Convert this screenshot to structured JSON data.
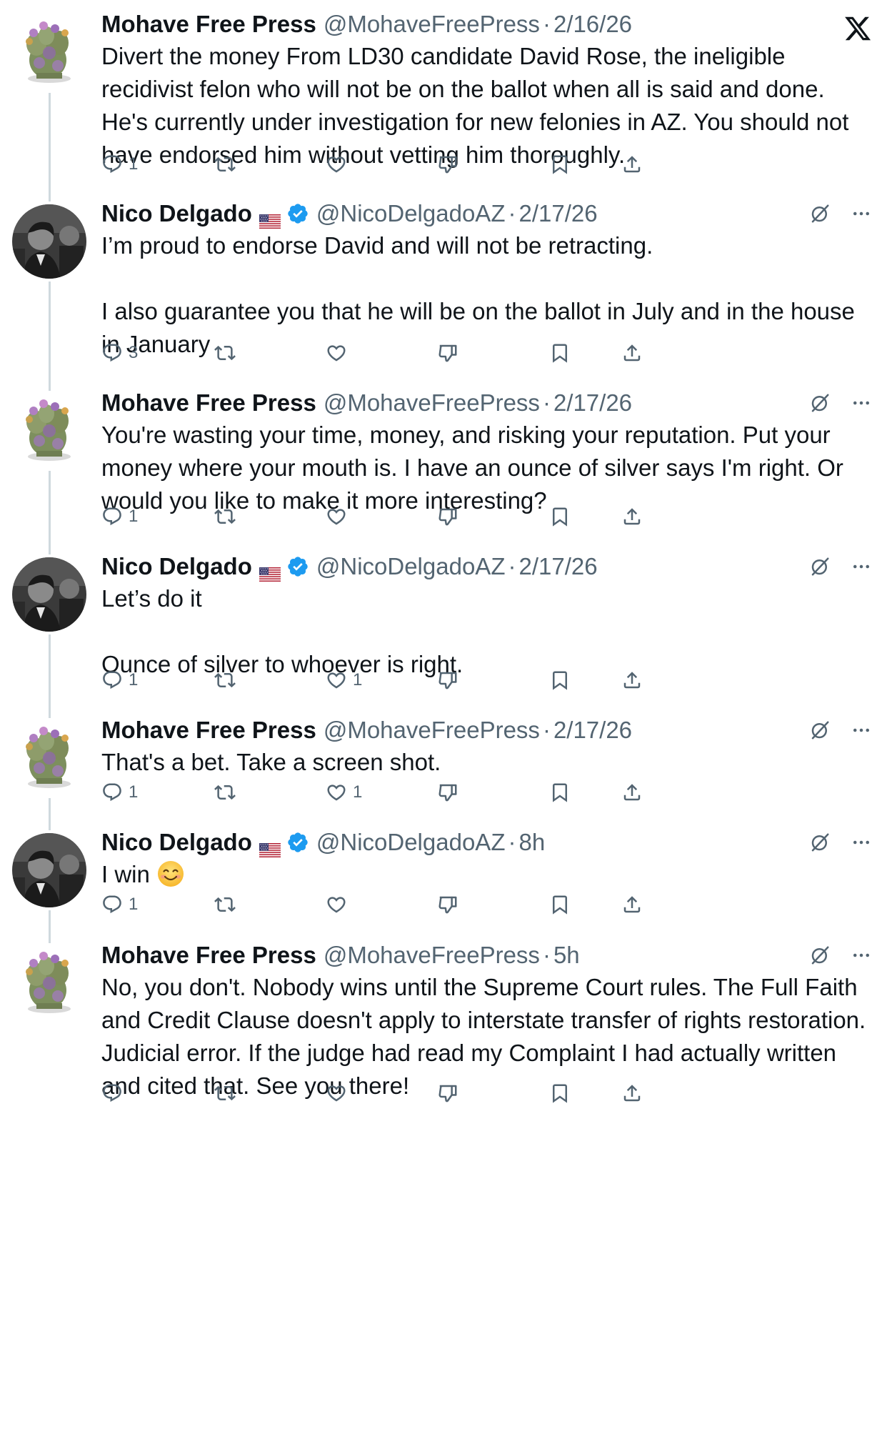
{
  "app": {
    "logo": "x-logo-icon"
  },
  "tweets": [
    {
      "name": "Mohave Free Press",
      "handle": "@MohaveFreePress",
      "dot": "·",
      "date": "2/16/26",
      "verified": false,
      "flag": false,
      "lines": [
        "Divert the money From LD30 candidate David Rose, the ineligible recidivist felon who will not be on the ballot when all is said and done. He's currently under investigation for new felonies in AZ. You should not have endorsed him without vetting him thoroughly."
      ],
      "replies": "1",
      "reposts": "",
      "likes": ""
    },
    {
      "name": "Nico Delgado",
      "handle": "@NicoDelgadoAZ",
      "dot": "·",
      "date": "2/17/26",
      "verified": true,
      "flag": true,
      "lines": [
        "I’m proud to endorse David and will not be retracting.",
        "",
        "I also guarantee you that he will be on the ballot in July and in the house in January"
      ],
      "replies": "3",
      "reposts": "",
      "likes": ""
    },
    {
      "name": "Mohave Free Press",
      "handle": "@MohaveFreePress",
      "dot": "·",
      "date": "2/17/26",
      "verified": false,
      "flag": false,
      "lines": [
        "You're wasting your time, money, and risking your reputation. Put your money where your mouth is. I have an ounce of silver says I'm right. Or would you like to make it more interesting?"
      ],
      "replies": "1",
      "reposts": "",
      "likes": ""
    },
    {
      "name": "Nico Delgado",
      "handle": "@NicoDelgadoAZ",
      "dot": "·",
      "date": "2/17/26",
      "verified": true,
      "flag": true,
      "lines": [
        "Let’s do it",
        "",
        "Ounce of silver to whoever is right."
      ],
      "replies": "1",
      "reposts": "",
      "likes": "1"
    },
    {
      "name": "Mohave Free Press",
      "handle": "@MohaveFreePress",
      "dot": "·",
      "date": "2/17/26",
      "verified": false,
      "flag": false,
      "lines": [
        "That's a bet. Take a screen shot."
      ],
      "replies": "1",
      "reposts": "",
      "likes": "1"
    },
    {
      "name": "Nico Delgado",
      "handle": "@NicoDelgadoAZ",
      "dot": "·",
      "date": "8h",
      "verified": true,
      "flag": true,
      "lines": [
        "I win "
      ],
      "emoji": "smiling-face-emoji",
      "replies": "1",
      "reposts": "",
      "likes": ""
    },
    {
      "name": "Mohave Free Press",
      "handle": "@MohaveFreePress",
      "dot": "·",
      "date": "5h",
      "verified": false,
      "flag": false,
      "lines": [
        "No, you don't. Nobody wins until the Supreme Court rules. The Full Faith and Credit Clause doesn't apply to interstate transfer of rights restoration. Judicial error. If the judge had read my Complaint I had actually written and cited that. See you there!"
      ],
      "replies": "",
      "reposts": "",
      "likes": ""
    }
  ],
  "colors": {
    "text": "#0f1419",
    "muted": "#536471",
    "verified": "#1d9bf0",
    "thread_line": "#cfd9de"
  },
  "icons": [
    "reply-icon",
    "repost-icon",
    "like-icon",
    "dislike-icon",
    "bookmark-icon",
    "share-icon",
    "grok-icon",
    "more-icon",
    "verified-badge-icon",
    "us-flag-icon"
  ]
}
